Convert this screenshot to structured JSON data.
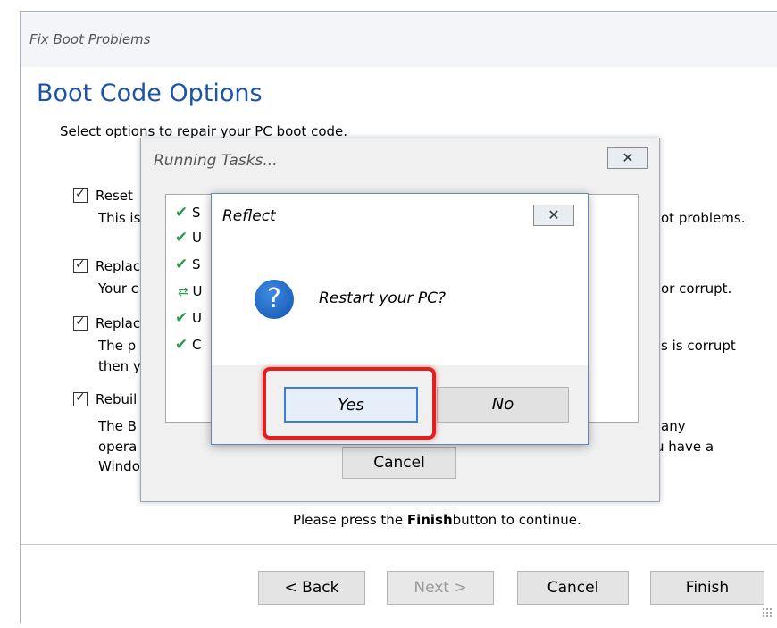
{
  "wizard": {
    "title": "Fix Boot Problems",
    "heading": "Boot Code Options",
    "subheading": "Select options to repair your PC boot code.",
    "options": [
      {
        "title": "Reset",
        "desc": [
          "This is",
          "ot problems."
        ],
        "checked": true
      },
      {
        "title": "Replac",
        "desc": [
          "Your c",
          "or corrupt."
        ],
        "checked": true
      },
      {
        "title": "Replac",
        "desc": [
          "The p",
          "s is corrupt",
          "then y"
        ],
        "checked": true
      },
      {
        "title": "Rebuil",
        "desc": [
          "The B",
          "any",
          "opera",
          "u have a",
          "Windo"
        ],
        "checked": true
      }
    ],
    "finish_hint_prefix": "Please press the ",
    "finish_hint_bold": "Finish",
    "finish_hint_suffix": "button to continue.",
    "buttons": {
      "back": "< Back",
      "next": "Next >",
      "cancel": "Cancel",
      "finish": "Finish"
    }
  },
  "tasks_dialog": {
    "title": "Running Tasks...",
    "close_glyph": "✕",
    "items": [
      {
        "text": "S",
        "status": "done"
      },
      {
        "text": "U",
        "status": "done"
      },
      {
        "text": "S",
        "status": "done"
      },
      {
        "text": "U",
        "status": "running"
      },
      {
        "text": "U",
        "status": "done"
      },
      {
        "text": "C",
        "status": "done"
      }
    ],
    "cancel_label": "Cancel"
  },
  "reflect_dialog": {
    "title": "Reflect",
    "close_glyph": "✕",
    "icon": "question-icon",
    "message": "Restart your PC?",
    "yes_label": "Yes",
    "no_label": "No"
  },
  "colors": {
    "heading": "#1d53a8",
    "check": "#2e9a4e",
    "highlight": "#e02020",
    "focus_border": "#3c7fd6"
  }
}
